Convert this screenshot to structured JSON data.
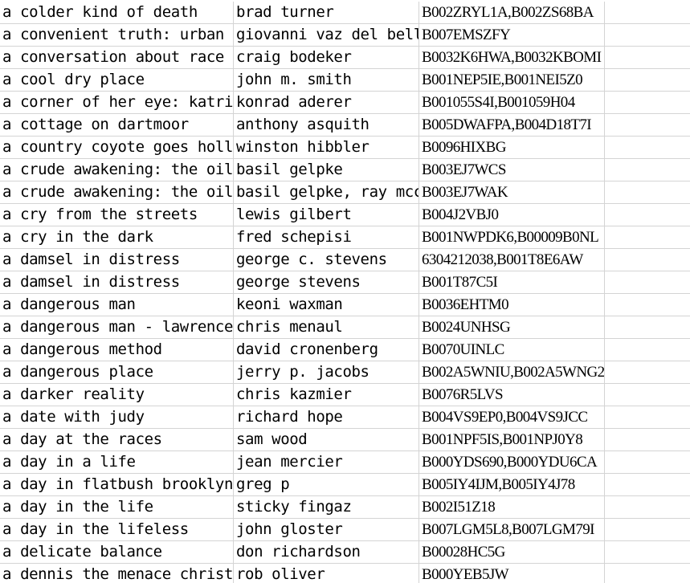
{
  "rows": [
    {
      "title": "a colder kind of death",
      "director": "brad turner",
      "asin": "B002ZRYL1A,B002ZS68BA"
    },
    {
      "title": "a convenient truth: urban",
      "director": "giovanni vaz del bell",
      "asin": "B007EMSZFY"
    },
    {
      "title": "a conversation about race",
      "director": "craig bodeker",
      "asin": "B0032K6HWA,B0032KBOMI"
    },
    {
      "title": "a cool dry place",
      "director": "john m. smith",
      "asin": "B001NEP5IE,B001NEI5Z0"
    },
    {
      "title": "a corner of her eye: katri",
      "director": "konrad aderer",
      "asin": "B001055S4I,B001059H04"
    },
    {
      "title": "a cottage on dartmoor",
      "director": "anthony asquith",
      "asin": "B005DWAFPA,B004D18T7I"
    },
    {
      "title": "a country coyote goes holl",
      "director": "winston hibbler",
      "asin": "B0096HIXBG"
    },
    {
      "title": "a crude awakening: the oil",
      "director": "basil gelpke",
      "asin": "B003EJ7WCS"
    },
    {
      "title": "a crude awakening: the oil",
      "director": "basil gelpke, ray mcc",
      "asin": "B003EJ7WAK"
    },
    {
      "title": "a cry from the streets",
      "director": "lewis gilbert",
      "asin": "B004J2VBJ0"
    },
    {
      "title": "a cry in the dark",
      "director": "fred schepisi",
      "asin": "B001NWPDK6,B00009B0NL"
    },
    {
      "title": "a damsel in distress",
      "director": "george c. stevens",
      "asin": "6304212038,B001T8E6AW"
    },
    {
      "title": "a damsel in distress",
      "director": "george stevens",
      "asin": "B001T87C5I"
    },
    {
      "title": "a dangerous man",
      "director": "keoni waxman",
      "asin": "B0036EHTM0"
    },
    {
      "title": "a dangerous man - lawrence",
      "director": "chris menaul",
      "asin": "B0024UNHSG"
    },
    {
      "title": "a dangerous method",
      "director": "david cronenberg",
      "asin": "B0070UINLC"
    },
    {
      "title": "a dangerous place",
      "director": "jerry p. jacobs",
      "asin": "B002A5WNIU,B002A5WNG2"
    },
    {
      "title": "a darker reality",
      "director": "chris kazmier",
      "asin": "B0076R5LVS"
    },
    {
      "title": "a date with judy",
      "director": "richard hope",
      "asin": "B004VS9EP0,B004VS9JCC"
    },
    {
      "title": "a day at the races",
      "director": "sam wood",
      "asin": "B001NPF5IS,B001NPJ0Y8"
    },
    {
      "title": "a day in a life",
      "director": "jean mercier",
      "asin": "B000YDS690,B000YDU6CA"
    },
    {
      "title": "a day in flatbush brooklyn",
      "director": "greg p",
      "asin": "B005IY4IJM,B005IY4J78"
    },
    {
      "title": "a day in the life",
      "director": "sticky fingaz",
      "asin": "B002I51Z18"
    },
    {
      "title": "a day in the lifeless",
      "director": "john gloster",
      "asin": "B007LGM5L8,B007LGM79I"
    },
    {
      "title": "a delicate balance",
      "director": "don richardson",
      "asin": "B00028HC5G"
    },
    {
      "title": "a dennis the menace christ",
      "director": "rob oliver",
      "asin": "B000YEB5JW"
    }
  ]
}
